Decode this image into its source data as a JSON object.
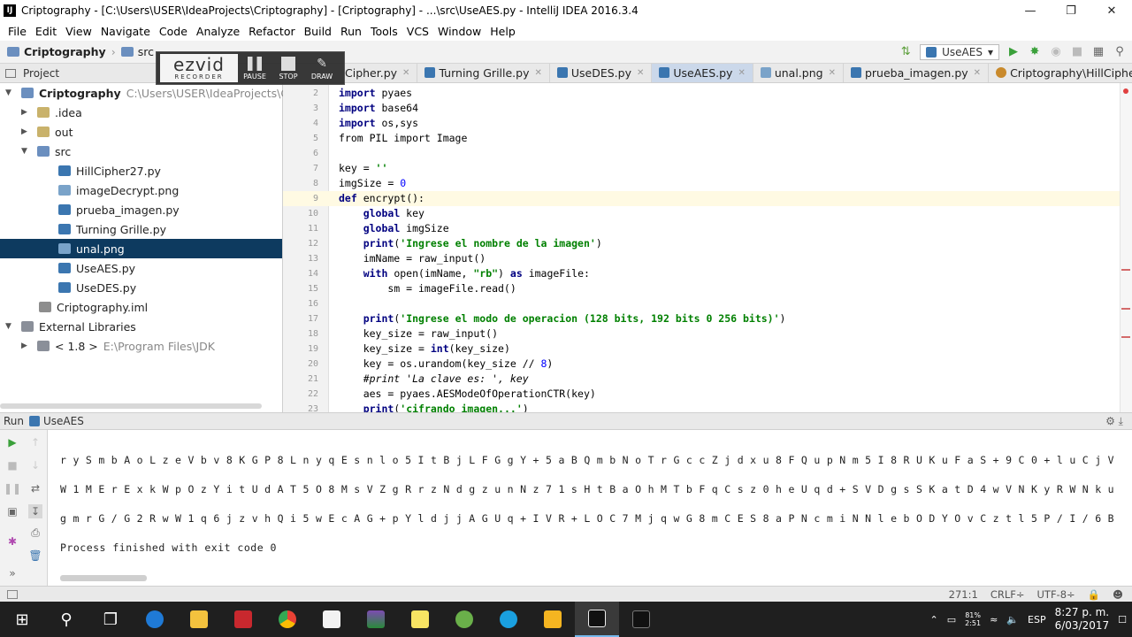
{
  "window": {
    "title": "Criptography - [C:\\Users\\USER\\IdeaProjects\\Criptography] - [Criptography] - ...\\src\\UseAES.py - IntelliJ IDEA 2016.3.4"
  },
  "menu": [
    "File",
    "Edit",
    "View",
    "Navigate",
    "Code",
    "Analyze",
    "Refactor",
    "Build",
    "Run",
    "Tools",
    "VCS",
    "Window",
    "Help"
  ],
  "navbar": {
    "project": "Criptography",
    "src": "src",
    "run_config": "UseAES"
  },
  "ezvid": {
    "logo": "ezvid",
    "logo_sub": "RECORDER",
    "pause": "PAUSE",
    "stop": "STOP",
    "draw": "DRAW"
  },
  "project_panel": {
    "header": "Project",
    "tree": [
      {
        "label": "Criptography",
        "extra": "C:\\Users\\USER\\IdeaProjects\\Criptogra",
        "icon": "folder"
      },
      {
        "label": ".idea",
        "icon": "folder"
      },
      {
        "label": "out",
        "icon": "folder"
      },
      {
        "label": "src",
        "icon": "folder"
      },
      {
        "label": "HillCipher27.py",
        "icon": "py"
      },
      {
        "label": "imageDecrypt.png",
        "icon": "png"
      },
      {
        "label": "prueba_imagen.py",
        "icon": "py"
      },
      {
        "label": "Turning Grille.py",
        "icon": "py"
      },
      {
        "label": "unal.png",
        "icon": "png"
      },
      {
        "label": "UseAES.py",
        "icon": "py"
      },
      {
        "label": "UseDES.py",
        "icon": "py"
      },
      {
        "label": "Criptography.iml",
        "icon": "iml"
      },
      {
        "label": "External Libraries",
        "icon": "lib"
      },
      {
        "label": "< 1.8 >",
        "extra": "E:\\Program Files\\JDK",
        "icon": "lib"
      }
    ]
  },
  "tabs": [
    "Cipher.py",
    "Turning Grille.py",
    "UseDES.py",
    "UseAES.py",
    "unal.png",
    "prueba_imagen.py",
    "Criptography\\HillCipher.py"
  ],
  "editor": {
    "line_numbers": [
      "2",
      "3",
      "4",
      "5",
      "6",
      "7",
      "8",
      "9",
      "10",
      "11",
      "12",
      "13",
      "14",
      "15",
      "16",
      "17",
      "18",
      "19",
      "20",
      "21",
      "22",
      "23"
    ],
    "code": [
      "import pyaes",
      "import base64",
      "import os,sys",
      "from PIL import Image",
      "",
      "key = ''",
      "imgSize = 0",
      "def encrypt():",
      "    global key",
      "    global imgSize",
      "    print('Ingrese el nombre de la imagen')",
      "    imName = raw_input()",
      "    with open(imName, \"rb\") as imageFile:",
      "        sm = imageFile.read()",
      "",
      "    print('Ingrese el modo de operacion (128 bits, 192 bits 0 256 bits)')",
      "    key_size = raw_input()",
      "    key_size = int(key_size)",
      "    key = os.urandom(key_size // 8)",
      "    #print 'La clave es: ', key",
      "    aes = pyaes.AESModeOfOperationCTR(key)",
      "    print('cifrando imagen...')"
    ]
  },
  "run_panel": {
    "label": "Run",
    "config": "UseAES",
    "output": [
      "r y S m b A o L z e V b v 8 K G P 8 L n y q E s n l o 5 I t B j L F G g Y + 5 a B Q m b N o T r G c c Z j d x u 8 F Q u p N m 5 I 8 R U K u F a S + 9 C 0 + l u C j V",
      "W 1 M E r E x k W p O z Y i t U d A T 5 O 8 M s V Z g R r z N d g z u n N z 7 1 s H t B a O h M T b F q C s z 0 h e U q d + S V D g s S K a t D 4 w V N K y R W N k u",
      "g m r G / G 2 R w W 1 q 6 j z v h Q i 5 w E c A G + p Y l d j j A G U q + I V R + L O C 7 M j q w G 8 m C E S 8 a P N c m i N N l e b O D Y O v C z t l 5 P / I / 6 B",
      "Process finished with exit code 0"
    ]
  },
  "status": {
    "position": "271:1",
    "line_sep": "CRLF÷",
    "encoding": "UTF-8÷"
  },
  "taskbar": {
    "language": "ESP",
    "battery": "81%",
    "battery_time": "2:51",
    "time": "8:27 p. m.",
    "date": "6/03/2017"
  }
}
